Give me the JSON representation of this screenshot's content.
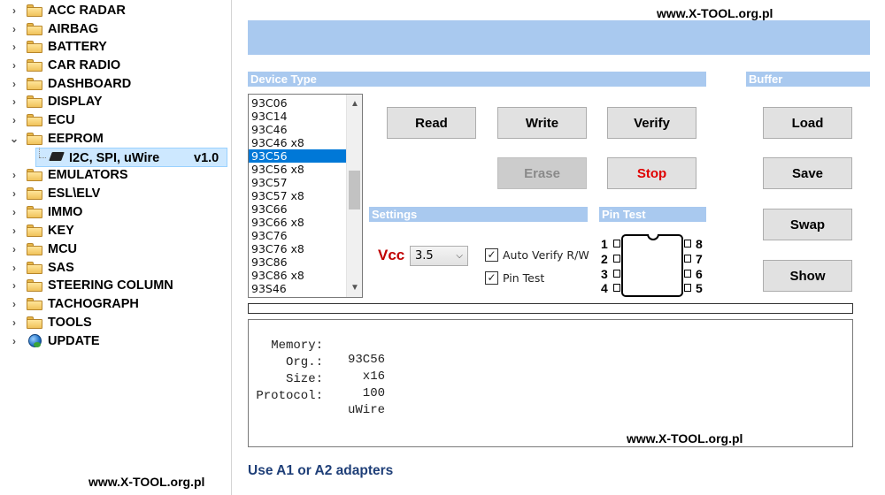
{
  "watermarks": {
    "top": "www.X-TOOL.org.pl",
    "info": "www.X-TOOL.org.pl",
    "bottom": "www.X-TOOL.org.pl"
  },
  "sidebar": {
    "items": [
      {
        "label": "ACC RADAR",
        "chevron": "›"
      },
      {
        "label": "AIRBAG",
        "chevron": "›"
      },
      {
        "label": "BATTERY",
        "chevron": "›"
      },
      {
        "label": "CAR RADIO",
        "chevron": "›"
      },
      {
        "label": "DASHBOARD",
        "chevron": "›"
      },
      {
        "label": "DISPLAY",
        "chevron": "›"
      },
      {
        "label": "ECU",
        "chevron": "›"
      },
      {
        "label": "EEPROM",
        "chevron": "⌄"
      },
      {
        "label": "EMULATORS",
        "chevron": "›"
      },
      {
        "label": "ESL\\ELV",
        "chevron": "›"
      },
      {
        "label": "IMMO",
        "chevron": "›"
      },
      {
        "label": "KEY",
        "chevron": "›"
      },
      {
        "label": "MCU",
        "chevron": "›"
      },
      {
        "label": "SAS",
        "chevron": "›"
      },
      {
        "label": "STEERING COLUMN",
        "chevron": "›"
      },
      {
        "label": "TACHOGRAPH",
        "chevron": "›"
      },
      {
        "label": "TOOLS",
        "chevron": "›"
      },
      {
        "label": "UPDATE",
        "chevron": "›"
      }
    ],
    "selected_child": {
      "label": "I2C, SPI, uWire",
      "version": "v1.0"
    }
  },
  "device_type": {
    "title": "Device Type",
    "items": [
      "93C06",
      "93C14",
      "93C46",
      "93C46 x8",
      "93C56",
      "93C56 x8",
      "93C57",
      "93C57 x8",
      "93C66",
      "93C66 x8",
      "93C76",
      "93C76 x8",
      "93C86",
      "93C86 x8",
      "93S46"
    ],
    "selected_index": 4,
    "scroll_up": "▲",
    "scroll_down": "▼"
  },
  "buttons": {
    "read": "Read",
    "write": "Write",
    "verify": "Verify",
    "erase": "Erase",
    "stop": "Stop"
  },
  "buffer": {
    "title": "Buffer",
    "load": "Load",
    "save": "Save",
    "swap": "Swap",
    "show": "Show"
  },
  "settings": {
    "title": "Settings",
    "vcc_label": "Vcc",
    "vcc_value": "3.5",
    "auto_verify": "Auto Verify R/W",
    "pin_test": "Pin Test",
    "check": "✓"
  },
  "pin_test": {
    "title": "Pin Test",
    "left_pins": [
      "1",
      "2",
      "3",
      "4"
    ],
    "right_pins": [
      "8",
      "7",
      "6",
      "5"
    ]
  },
  "progress": {
    "value_percent": 0
  },
  "info": {
    "rows": [
      {
        "key": "Memory:",
        "value": "93C56"
      },
      {
        "key": "Org.:",
        "value": "  x16"
      },
      {
        "key": "Size:",
        "value": "  100"
      },
      {
        "key": "Protocol:",
        "value": "uWire"
      }
    ]
  },
  "footer": {
    "note": "Use A1 or A2 adapters"
  }
}
